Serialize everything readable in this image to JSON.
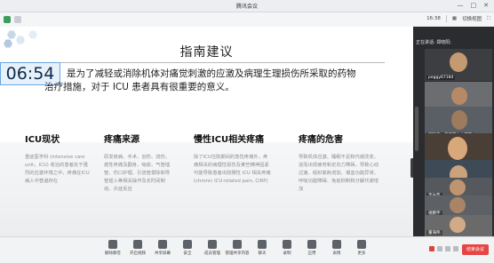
{
  "window": {
    "title": "腾讯会议"
  },
  "topbar": {
    "time": "16:38",
    "switch_view": "切换视图"
  },
  "slide": {
    "title": "指南建议",
    "timer": "06:54",
    "intro_line1": "是为了减轻或消除机体对痛觉刺激的应激及病理生理损伤所采取的药物",
    "intro_line2": "治疗措施，对于 ICU 患者具有很重要的意义。",
    "columns": [
      {
        "heading": "ICU现状",
        "body": "重症医学科 (intensive care unit，ICU) 收治的患者处于强烈的应激环境之中，疼痛在ICU病人中普遍存在"
      },
      {
        "heading": "疼痛来源",
        "body": "原发疾病、手术、创伤、烧伤、癌性疼痛及翻身、吸痰、气管插管、伤口护理、引流管拔除和导管插入等相关操作及长时间制动、炎症反应"
      },
      {
        "heading": "慢性ICU相关疼痛",
        "body": "除了ICU住院期间的急性疼痛外，疼痛相关的病理性损伤及某些精神因素可能导致患者出院慢性 ICU 相关疼痛 (chronic ICU-related pain, CIRP)"
      },
      {
        "heading": "疼痛的危害",
        "body": "导致机体应激、睡眠不足和代谢改变，进而出现疲劳和定向力障碍，导致心动过速、组织氧耗增加、凝血功能异常、呼吸功能障碍、免疫抑制和分解代谢增加"
      }
    ]
  },
  "participants": {
    "speaker_label": "正在讲话: 郑晓阳;",
    "tiles": [
      {
        "name": "peggy67184"
      },
      {
        "name": ""
      },
      {
        "name": "邱阿伟 - 重庆市中心医院"
      },
      {
        "name": ""
      },
      {
        "name": "王叶雨"
      },
      {
        "name": "李光磊"
      },
      {
        "name": "谢鹏宇"
      },
      {
        "name": "董海伟"
      }
    ]
  },
  "toolbar": {
    "items": [
      "解除静音",
      "开启视频",
      "共享屏幕",
      "安全",
      "成员管理",
      "管理共享内容",
      "聊天",
      "录制",
      "应用",
      "表情",
      "更多"
    ],
    "end_label": "结束会议"
  }
}
